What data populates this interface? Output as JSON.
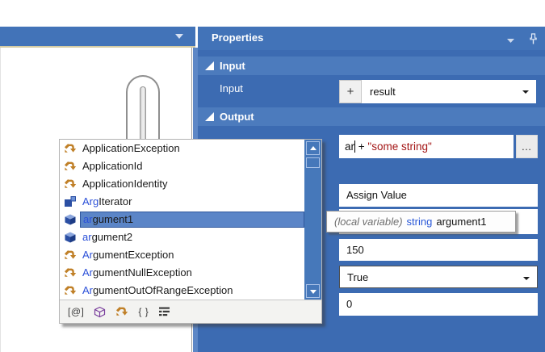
{
  "colors": {
    "panel_blue": "#3c6bb2",
    "header_blue": "#4c7bbd",
    "titlebar_blue": "#4273b8",
    "splitter_blue": "#5d87c6",
    "tan_border": "#d5cca4",
    "selection_blue": "#5b85c7",
    "match_blue": "#2b50d8",
    "string_red": "#a31515",
    "type_blue": "#2857d8"
  },
  "icons": {
    "chevron": "▾",
    "expander": "◢",
    "pin": "pushpin",
    "scroll_up": "▲",
    "scroll_down": "▼",
    "dropdown": "▾"
  },
  "properties": {
    "title": "Properties",
    "input_section": "Input",
    "output_section": "Output",
    "input_row": {
      "label": "Input",
      "add_label": "+",
      "value": "result"
    },
    "expression": {
      "before_caret": "ar",
      "after_caret": " + ",
      "string_literal": "\"some string\"",
      "ellipsis": "…"
    },
    "fields": {
      "display_name": "Assign Value",
      "num": "150",
      "bool": "True",
      "zero": "0"
    },
    "tooltip": {
      "kind": "(local variable)",
      "type": "string",
      "name": "argument1"
    }
  },
  "completion": {
    "items": [
      {
        "icon": "class",
        "match": "",
        "rest": "ApplicationException",
        "selected": false
      },
      {
        "icon": "class",
        "match": "",
        "rest": "ApplicationId",
        "selected": false
      },
      {
        "icon": "class",
        "match": "",
        "rest": "ApplicationIdentity",
        "selected": false
      },
      {
        "icon": "struct",
        "match": "Arg",
        "rest": "Iterator",
        "selected": false
      },
      {
        "icon": "variable",
        "match": "ar",
        "rest": "gument1",
        "selected": true
      },
      {
        "icon": "variable",
        "match": "ar",
        "rest": "gument2",
        "selected": false
      },
      {
        "icon": "class",
        "match": "Ar",
        "rest": "gumentException",
        "selected": false
      },
      {
        "icon": "class",
        "match": "Ar",
        "rest": "gumentNullException",
        "selected": false
      },
      {
        "icon": "class",
        "match": "Ar",
        "rest": "gumentOutOfRangeException",
        "selected": false
      }
    ],
    "filters": [
      {
        "name": "filter-at-button",
        "label": "[@]"
      },
      {
        "name": "filter-namespaces-button",
        "icon": "cube"
      },
      {
        "name": "filter-classes-button",
        "icon": "class"
      },
      {
        "name": "filter-snippets-button",
        "label": "{ }"
      },
      {
        "name": "filter-members-button",
        "icon": "outline"
      }
    ]
  }
}
